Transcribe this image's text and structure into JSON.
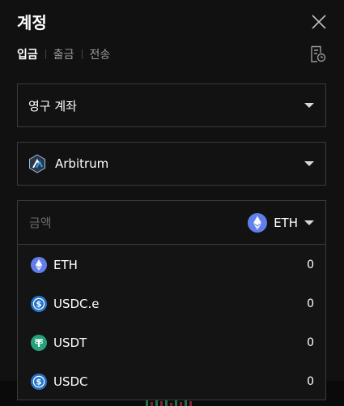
{
  "header": {
    "title": "계정"
  },
  "tabs": [
    {
      "label": "입금",
      "active": true
    },
    {
      "label": "출금",
      "active": false
    },
    {
      "label": "전송",
      "active": false
    }
  ],
  "account_select": {
    "value": "영구 계좌"
  },
  "network_select": {
    "value": "Arbitrum",
    "icon": "arbitrum-logo-icon"
  },
  "amount": {
    "placeholder": "금액",
    "value": "",
    "token": "ETH",
    "token_icon": "eth-icon"
  },
  "token_dropdown": {
    "items": [
      {
        "symbol": "ETH",
        "balance": "0",
        "icon": "eth-icon"
      },
      {
        "symbol": "USDC.e",
        "balance": "0",
        "icon": "usdc-icon"
      },
      {
        "symbol": "USDT",
        "balance": "0",
        "icon": "usdt-icon"
      },
      {
        "symbol": "USDC",
        "balance": "0",
        "icon": "usdc-icon"
      }
    ]
  },
  "colors": {
    "eth": "#627eea",
    "usdc": "#2775ca",
    "usdt": "#26a17b",
    "arbitrum_bg": "#2d374b",
    "arbitrum_blue": "#28a0f0"
  }
}
